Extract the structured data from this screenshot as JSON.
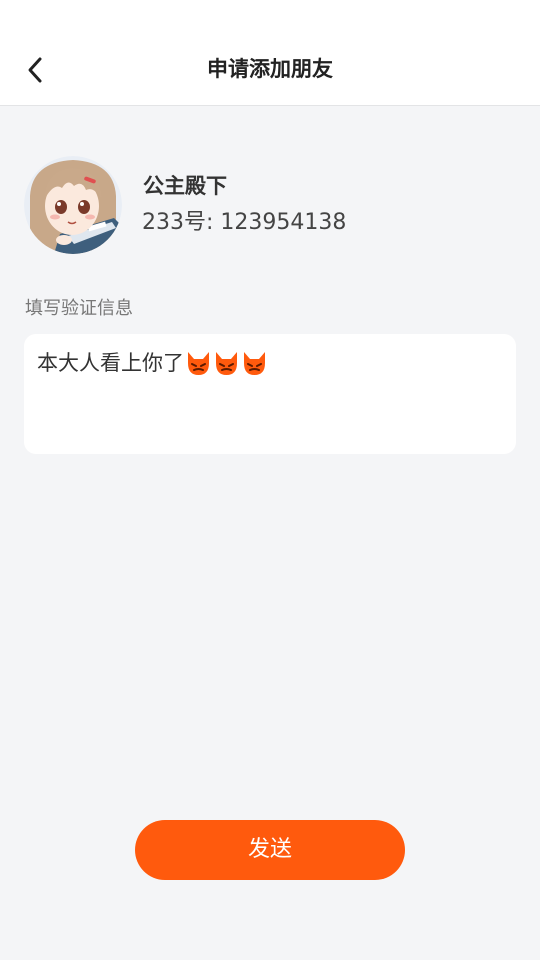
{
  "header": {
    "title": "申请添加朋友",
    "back_icon": "chevron-left-icon"
  },
  "profile": {
    "avatar_icon": "anime-girl-avatar",
    "name": "公主殿下",
    "id_line": "233号: 123954138"
  },
  "verification": {
    "label": "填写验证信息",
    "message": "本大人看上你了",
    "emoji_icons": [
      "devil-face-icon",
      "devil-face-icon",
      "devil-face-icon"
    ]
  },
  "actions": {
    "send_label": "发送"
  },
  "colors": {
    "accent": "#ff5a0d",
    "background": "#f4f5f7",
    "surface": "#ffffff"
  }
}
